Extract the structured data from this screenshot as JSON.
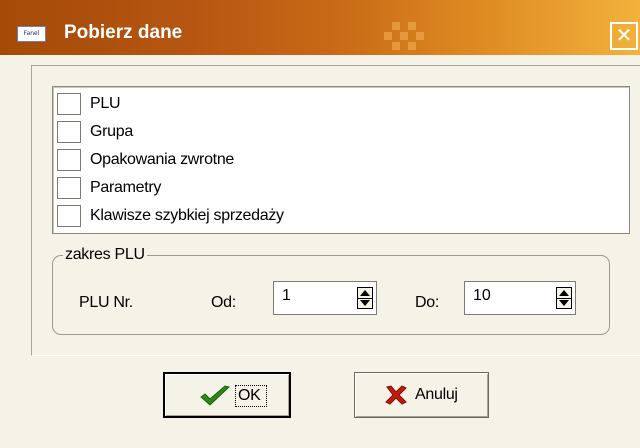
{
  "window": {
    "title": "Pobierz dane",
    "app_icon_text": "Fanel",
    "close_glyph": "✕"
  },
  "list": {
    "items": [
      {
        "label": "PLU",
        "checked": false
      },
      {
        "label": "Grupa",
        "checked": false
      },
      {
        "label": "Opakowania zwrotne",
        "checked": false
      },
      {
        "label": "Parametry",
        "checked": false
      },
      {
        "label": "Klawisze szybkiej sprzedaży",
        "checked": false
      }
    ]
  },
  "range": {
    "group_title": "zakres PLU",
    "plu_label": "PLU Nr.",
    "from_label": "Od:",
    "from_value": "1",
    "to_label": "Do:",
    "to_value": "10"
  },
  "buttons": {
    "ok_label": "OK",
    "ok_icon": "checkmark-icon",
    "ok_icon_color": "#2b8a17",
    "cancel_label": "Anuluj",
    "cancel_icon": "x-icon",
    "cancel_icon_color": "#c41b0f"
  },
  "colors": {
    "title_start": "#a54a08",
    "title_end": "#f2b23c",
    "face": "#f5f2e7"
  }
}
